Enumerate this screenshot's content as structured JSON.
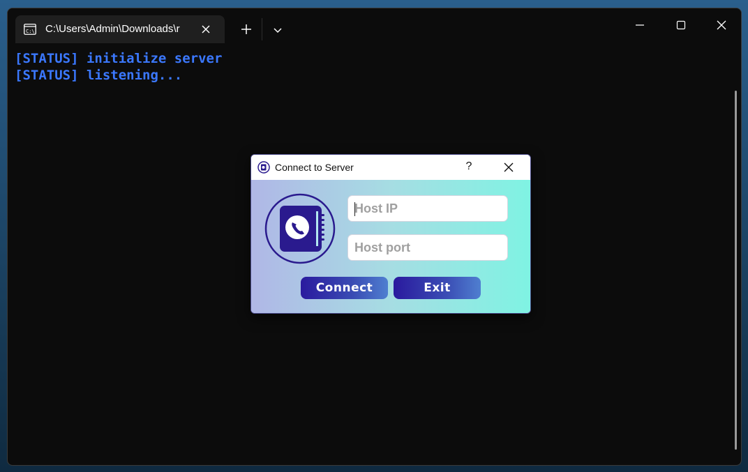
{
  "terminal": {
    "tab_title": "C:\\Users\\Admin\\Downloads\\r",
    "console_lines": [
      "[STATUS] initialize server",
      "[STATUS] listening..."
    ]
  },
  "dialog": {
    "title": "Connect to Server",
    "help_label": "?",
    "host_ip_placeholder": "Host IP",
    "host_port_placeholder": "Host port",
    "connect_label": "Connect",
    "exit_label": "Exit"
  },
  "colors": {
    "console_text": "#3b78ff",
    "button_gradient_start": "#2a1a9e",
    "dialog_gradient_end": "#7ff3e3"
  },
  "icons": [
    "terminal-icon",
    "close-icon",
    "plus-icon",
    "chevron-down-icon",
    "minimize-icon",
    "maximize-icon",
    "phonebook-icon",
    "app-icon"
  ]
}
